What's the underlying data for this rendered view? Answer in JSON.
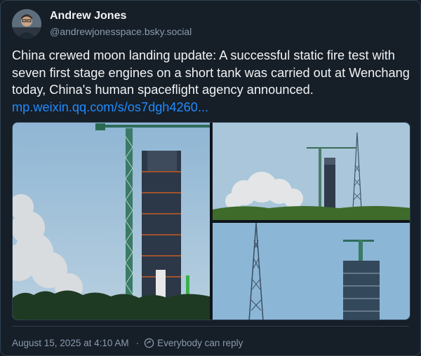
{
  "author": {
    "display_name": "Andrew Jones",
    "handle": "@andrewjonesspace.bsky.social"
  },
  "post": {
    "text": "China crewed moon landing update: A successful static fire test with seven first stage engines on a short tank was carried out at Wenchang today, China's human spaceflight agency announced.",
    "link": "mp.weixin.qq.com/s/os7dgh4260..."
  },
  "media": {
    "images": [
      {
        "description_icon": "launch-tower-image"
      },
      {
        "description_icon": "static-fire-image"
      },
      {
        "description_icon": "tower-crane-image"
      }
    ]
  },
  "footer": {
    "timestamp": "August 15, 2025 at 4:10 AM",
    "reply_setting": "Everybody can reply"
  },
  "colors": {
    "background": "#161e27",
    "link": "#208bfe",
    "muted": "#8a9bb0",
    "border": "#2e4052"
  }
}
